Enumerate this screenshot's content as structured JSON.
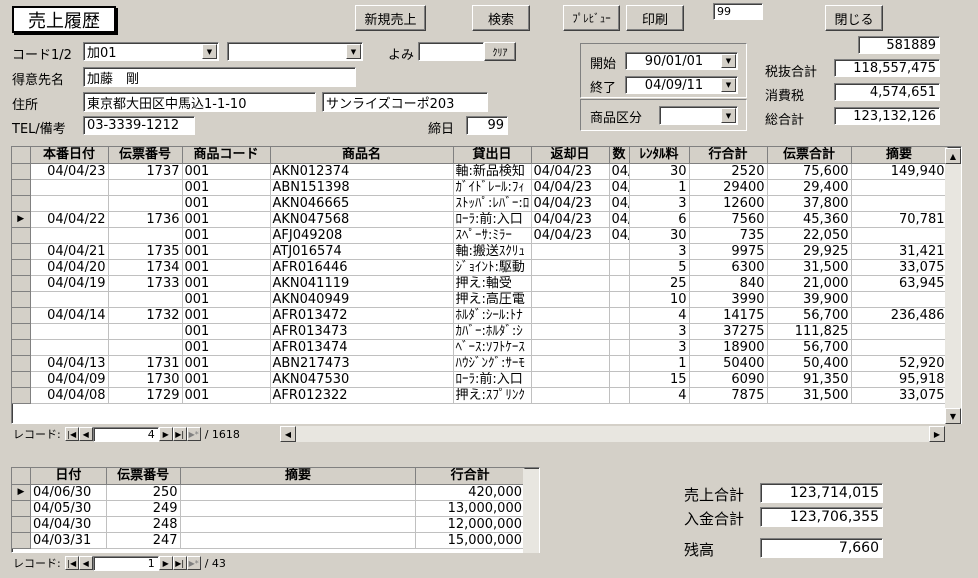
{
  "header": {
    "title": "売上履歴",
    "new_sale": "新規売上",
    "search": "検索",
    "preview": "ﾌﾟﾚﾋﾞｭｰ",
    "print": "印刷",
    "small_field": "99",
    "close": "閉じる"
  },
  "customer": {
    "code_label": "コード1/2",
    "code1": "加01",
    "code2": "",
    "yomi_label": "よみ",
    "yomi": "",
    "clear": "ｸﾘｱ",
    "name_label": "得意先名",
    "name": "加藤　剛",
    "address_label": "住所",
    "address1": "東京都大田区中馬込1-1-10",
    "address2": "サンライズコーポ203",
    "tel_label": "TEL/備考",
    "tel": "03-3339-1212",
    "closing_label": "締日",
    "closing": "99"
  },
  "period": {
    "start_label": "開始",
    "start": "90/01/01",
    "end_label": "終了",
    "end": "04/09/11",
    "cat_label": "商品区分",
    "cat": ""
  },
  "totals": {
    "top": "581889",
    "pretax_label": "税抜合計",
    "pretax": "118,557,475",
    "tax_label": "消費税",
    "tax": "4,574,651",
    "grand_label": "総合計",
    "grand": "123,132,126"
  },
  "main_grid": {
    "columns": [
      "本番日付",
      "伝票番号",
      "商品コード",
      "商品名",
      "貸出日",
      "返却日",
      "数",
      "ﾚﾝﾀﾙ料",
      "行合計",
      "伝票合計",
      "摘要"
    ],
    "rows": [
      [
        "04/04/23",
        "1737",
        "001",
        "AKN012374",
        "軸:新品検知",
        "04/04/23",
        "04/05/30",
        "30",
        "2520",
        "75,600",
        "149,940",
        ""
      ],
      [
        "",
        "",
        "001",
        "ABN151398",
        "ｶﾞｲﾄﾞﾚｰﾙ:ﾌｨ",
        "04/04/23",
        "04/05/30",
        "1",
        "29400",
        "29,400",
        "",
        ""
      ],
      [
        "",
        "",
        "001",
        "AKN046665",
        "ｽﾄｯﾊﾟ:ﾚﾊﾞｰ:ﾛ",
        "04/04/23",
        "04/05/30",
        "3",
        "12600",
        "37,800",
        "",
        ""
      ],
      [
        "04/04/22",
        "1736",
        "001",
        "AKN047568",
        "ﾛｰﾗ:前:入口",
        "04/04/23",
        "04/05/25",
        "6",
        "7560",
        "45,360",
        "70,781",
        ""
      ],
      [
        "",
        "",
        "001",
        "AFJ049208",
        "ｽﾍﾟｰｻ:ﾐﾗｰ",
        "04/04/23",
        "04/05/25",
        "30",
        "735",
        "22,050",
        "",
        ""
      ],
      [
        "04/04/21",
        "1735",
        "001",
        "ATJ016574",
        "軸:搬送ｽｸﾘｭ",
        "",
        "",
        "3",
        "9975",
        "29,925",
        "31,421",
        ""
      ],
      [
        "04/04/20",
        "1734",
        "001",
        "AFR016446",
        "ｼﾞｮｲﾝﾄ:駆動",
        "",
        "",
        "5",
        "6300",
        "31,500",
        "33,075",
        ""
      ],
      [
        "04/04/19",
        "1733",
        "001",
        "AKN041119",
        "押え:軸受",
        "",
        "",
        "25",
        "840",
        "21,000",
        "63,945",
        ""
      ],
      [
        "",
        "",
        "001",
        "AKN040949",
        "押え:高圧電",
        "",
        "",
        "10",
        "3990",
        "39,900",
        "",
        ""
      ],
      [
        "04/04/14",
        "1732",
        "001",
        "AFR013472",
        "ﾎﾙﾀﾞ:ｼｰﾙ:ﾄﾅ",
        "",
        "",
        "4",
        "14175",
        "56,700",
        "236,486",
        ""
      ],
      [
        "",
        "",
        "001",
        "AFR013473",
        "ｶﾊﾞｰ:ﾎﾙﾀﾞ:ｼ",
        "",
        "",
        "3",
        "37275",
        "111,825",
        "",
        ""
      ],
      [
        "",
        "",
        "001",
        "AFR013474",
        "ﾍﾞｰｽ:ｿﾌﾄｹｰｽ",
        "",
        "",
        "3",
        "18900",
        "56,700",
        "",
        ""
      ],
      [
        "04/04/13",
        "1731",
        "001",
        "ABN217473",
        "ﾊｳｼﾞﾝｸﾞ:ｻｰﾓ",
        "",
        "",
        "1",
        "50400",
        "50,400",
        "52,920",
        ""
      ],
      [
        "04/04/09",
        "1730",
        "001",
        "AKN047530",
        "ﾛｰﾗ:前:入口",
        "",
        "",
        "15",
        "6090",
        "91,350",
        "95,918",
        ""
      ],
      [
        "04/04/08",
        "1729",
        "001",
        "AFR012322",
        "押え:ｽﾌﾟﾘﾝｸ",
        "",
        "",
        "4",
        "7875",
        "31,500",
        "33,075",
        ""
      ]
    ],
    "nav_label": "レコード:",
    "record": "4",
    "total": "/ 1618"
  },
  "payments": {
    "columns": [
      "日付",
      "伝票番号",
      "摘要",
      "行合計"
    ],
    "rows": [
      [
        "04/06/30",
        "250",
        "",
        "420,000"
      ],
      [
        "04/05/30",
        "249",
        "",
        "13,000,000"
      ],
      [
        "04/04/30",
        "248",
        "",
        "12,000,000"
      ],
      [
        "04/03/31",
        "247",
        "",
        "15,000,000"
      ]
    ],
    "nav_label": "レコード:",
    "record": "1",
    "total": "/ 43"
  },
  "summary": {
    "sales_label": "売上合計",
    "sales": "123,714,015",
    "paid_label": "入金合計",
    "paid": "123,706,355",
    "balance_label": "残高",
    "balance": "7,660"
  }
}
